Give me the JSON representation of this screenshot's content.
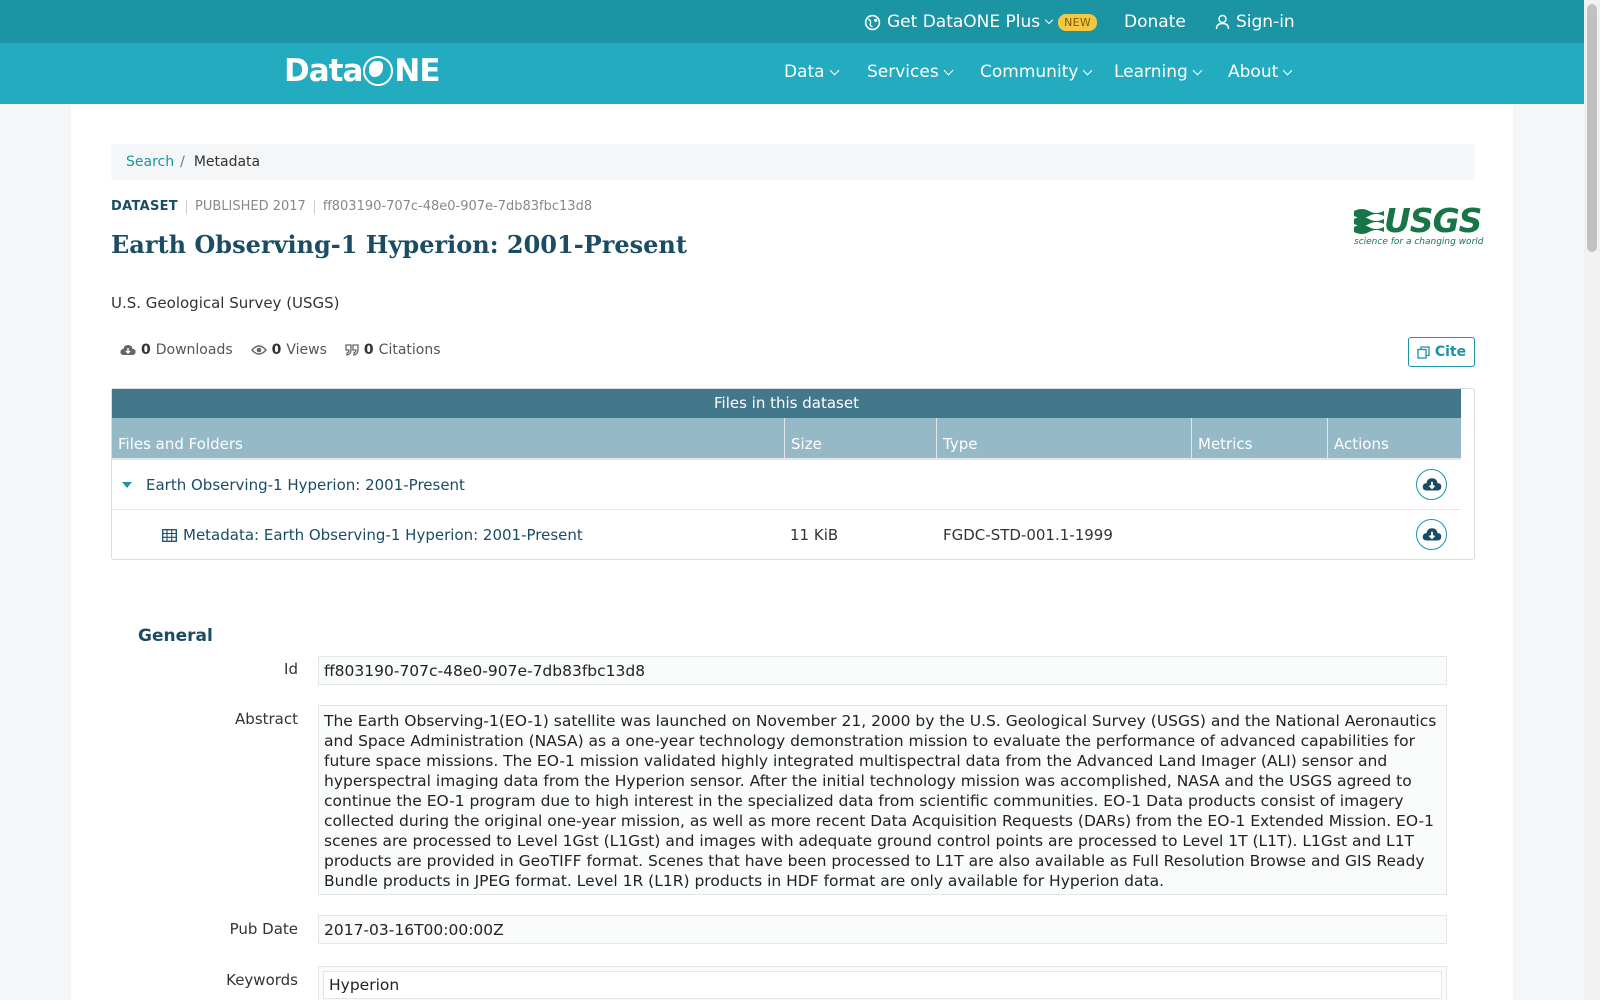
{
  "topbar": {
    "plus_label": "Get DataONE Plus",
    "new_badge": "NEW",
    "donate": "Donate",
    "signin": "Sign-in"
  },
  "brand": {
    "logo_text_left": "Data",
    "logo_text_right": "NE",
    "logo_icon": "globe-icon"
  },
  "nav": [
    "Data",
    "Services",
    "Community",
    "Learning",
    "About"
  ],
  "breadcrumb": {
    "search": "Search",
    "separator": "/",
    "current": "Metadata"
  },
  "dataset": {
    "type": "DATASET",
    "published": "PUBLISHED 2017",
    "id": "ff803190-707c-48e0-907e-7db83fbc13d8",
    "title": "Earth Observing-1 Hyperion: 2001-Present",
    "organization": "U.S. Geological Survey (USGS)",
    "logo_word": "USGS",
    "logo_tagline": "science for a changing world"
  },
  "stats": {
    "downloads_count": "0",
    "downloads_label": "Downloads",
    "views_count": "0",
    "views_label": "Views",
    "citations_count": "0",
    "citations_label": "Citations"
  },
  "cite_button": "Cite",
  "files": {
    "heading": "Files in this dataset",
    "columns": [
      "Files and Folders",
      "Size",
      "Type",
      "Metrics",
      "Actions"
    ],
    "package_name": "Earth Observing-1 Hyperion: 2001-Present",
    "file": {
      "name": "Metadata: Earth Observing-1 Hyperion: 2001-Present",
      "size": "11 KiB",
      "type": "FGDC-STD-001.1-1999"
    }
  },
  "general": {
    "heading": "General",
    "id_label": "Id",
    "id_value": "ff803190-707c-48e0-907e-7db83fbc13d8",
    "abstract_label": "Abstract",
    "abstract_value": "The Earth Observing-1(EO-1) satellite was launched on November 21, 2000 by the U.S. Geological Survey (USGS) and the National Aeronautics and Space Administration (NASA) as a one-year technology demonstration mission to evaluate the performance of advanced capabilities for future space missions. The EO-1 mission validated highly integrated multispectral data from the Advanced Land Imager (ALI) sensor and hyperspectral imaging data from the Hyperion sensor. After the initial technology mission was accomplished, NASA and the USGS agreed to continue the EO-1 program due to high interest in the specialized data from scientific communities. EO-1 Data products consist of imagery collected during the original one-year mission, as well as more recent Data Acquisition Requests (DARs) from the EO-1 Extended Mission. EO-1 scenes are processed to Level 1Gst (L1Gst) and images with adequate ground control points are processed to Level 1T (L1T). L1Gst and L1T products are provided in GeoTIFF format. Scenes that have been processed to L1T are also available as Full Resolution Browse and GIS Ready Bundle products in JPEG format. Level 1R (L1R) products in HDF format are only available for Hyperion data.",
    "pubdate_label": "Pub Date",
    "pubdate_value": "2017-03-16T00:00:00Z",
    "keywords_label": "Keywords",
    "keywords_value": "Hyperion"
  },
  "colors": {
    "topbar": "#1b94a4",
    "navbar": "#23abc0",
    "table_head": "#43788c",
    "table_cols": "#96b9c7",
    "title": "#1a4d63"
  }
}
